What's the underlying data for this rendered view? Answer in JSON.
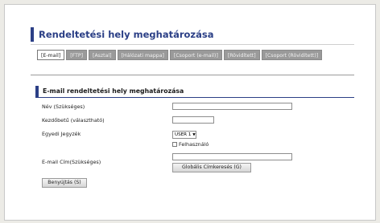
{
  "page": {
    "title": "Rendeltetési hely meghatározása"
  },
  "tabs": [
    {
      "label": "[E-mail]",
      "active": true
    },
    {
      "label": "[FTP]",
      "active": false
    },
    {
      "label": "[Asztal]",
      "active": false
    },
    {
      "label": "[Hálózati mappa]",
      "active": false
    },
    {
      "label": "[Csoport (e-mail)]",
      "active": false
    },
    {
      "label": "[Rövidített]",
      "active": false
    },
    {
      "label": "[Csoport (Rövidített)]",
      "active": false
    }
  ],
  "section": {
    "title": "E-mail rendeltetési hely meghatározása"
  },
  "form": {
    "name_label": "Név (Szükséges)",
    "name_value": "",
    "initial_label": "Kezdőbetű (választható)",
    "initial_value": "",
    "notebook_label": "Egyedi Jegyzék",
    "notebook_select_value": "USER 1",
    "user_checkbox_label": "Felhasználó",
    "user_checkbox_checked": false,
    "email_label": "E-mail Cím(Szükséges)",
    "email_value": "",
    "global_search_button": "Globális Címkeresés (G)"
  },
  "actions": {
    "submit_button": "Benyújtás (S)"
  },
  "colors": {
    "accent": "#2b3f86",
    "tab_inactive": "#9a9a9a"
  }
}
